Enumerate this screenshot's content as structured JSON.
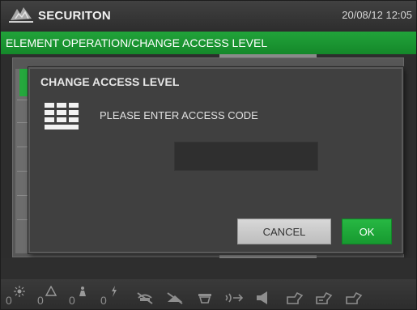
{
  "header": {
    "brand": "SECURITON",
    "datetime": "20/08/12 12:05"
  },
  "breadcrumb": {
    "path": "ELEMENT OPERATION/",
    "current": "CHANGE ACCESS LEVEL"
  },
  "dialog": {
    "title": "CHANGE ACCESS LEVEL",
    "prompt": "PLEASE ENTER ACCESS CODE",
    "code_value": "",
    "cancel_label": "CANCEL",
    "ok_label": "OK"
  },
  "status": {
    "counters": [
      {
        "name": "fire-alarm",
        "count": "0",
        "icon": "sun-burst-icon"
      },
      {
        "name": "warning",
        "count": "0",
        "icon": "triangle-warning-icon"
      },
      {
        "name": "fault",
        "count": "0",
        "icon": "person-icon"
      },
      {
        "name": "technical",
        "count": "0",
        "icon": "lightning-icon"
      }
    ],
    "icons": [
      "disabled-detector-icon",
      "disabled-control-icon",
      "sounder-icon",
      "transmission-icon",
      "speaker-icon",
      "access-level-1-icon",
      "access-level-2-icon",
      "access-level-3-icon"
    ]
  },
  "colors": {
    "accent_green": "#1a962f",
    "background": "#2d2d2d"
  }
}
